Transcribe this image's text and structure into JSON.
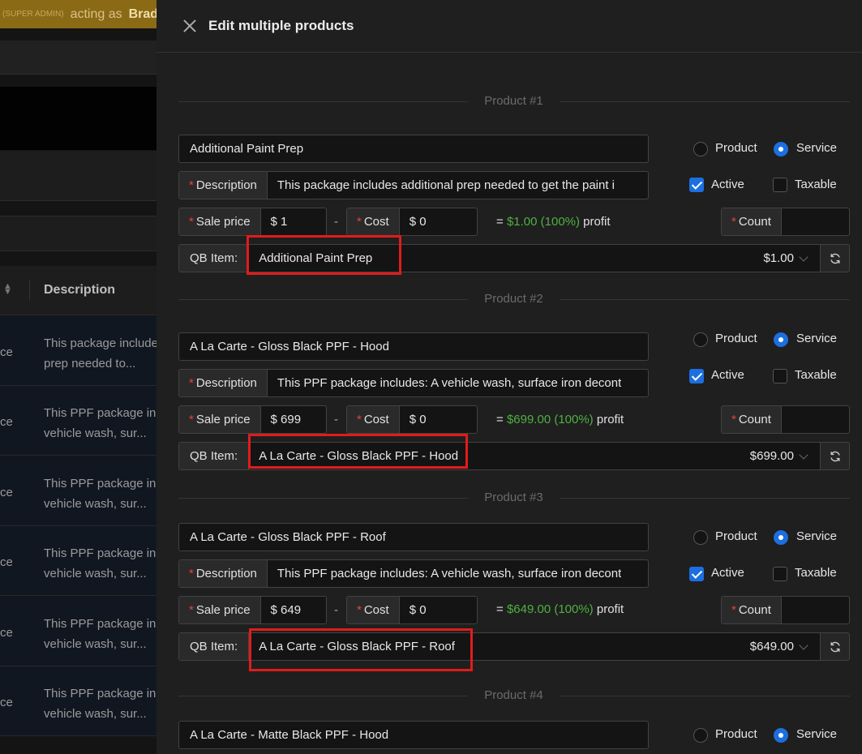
{
  "background": {
    "banner": {
      "role": "(SUPER ADMIN)",
      "acting": "acting as",
      "user": "Brad"
    },
    "table": {
      "description_header": "Description",
      "rows": [
        {
          "type": "ce",
          "line1": "This package include",
          "line2": "prep needed to..."
        },
        {
          "type": "ce",
          "line1": "This PPF package inc",
          "line2": "vehicle wash, sur..."
        },
        {
          "type": "ce",
          "line1": "This PPF package inc",
          "line2": "vehicle wash, sur..."
        },
        {
          "type": "ce",
          "line1": "This PPF package inc",
          "line2": "vehicle wash, sur..."
        },
        {
          "type": "ce",
          "line1": "This PPF package inc",
          "line2": "vehicle wash, sur..."
        },
        {
          "type": "ce",
          "line1": "This PPF package inc",
          "line2": "vehicle wash, sur..."
        }
      ]
    }
  },
  "drawer": {
    "title": "Edit multiple products",
    "labels": {
      "description": "Description",
      "sale_price": "Sale price",
      "cost": "Cost",
      "count": "Count",
      "qb_item": "QB Item:",
      "product": "Product",
      "service": "Service",
      "active": "Active",
      "taxable": "Taxable",
      "dash": "-",
      "profit_word": "profit"
    },
    "products": [
      {
        "heading": "Product #1",
        "name": "Additional Paint Prep",
        "description": "This package includes additional prep needed to get the paint i",
        "sale_price": "$ 1",
        "cost": "$ 0",
        "profit_prefix": "=",
        "profit_value": "$1.00 (100%)",
        "count": "",
        "qb_item": "Additional Paint Prep",
        "qb_price": "$1.00",
        "kind": "Service",
        "active": true,
        "taxable": false
      },
      {
        "heading": "Product #2",
        "name": "A La Carte - Gloss Black PPF - Hood",
        "description": "This PPF package includes:  A vehicle wash, surface iron decont",
        "sale_price": "$ 699",
        "cost": "$ 0",
        "profit_prefix": "=",
        "profit_value": "$699.00 (100%)",
        "count": "",
        "qb_item": "A La Carte - Gloss Black PPF - Hood",
        "qb_price": "$699.00",
        "kind": "Service",
        "active": true,
        "taxable": false
      },
      {
        "heading": "Product #3",
        "name": "A La Carte - Gloss Black PPF - Roof",
        "description": "This PPF package includes:  A vehicle wash, surface iron decont",
        "sale_price": "$ 649",
        "cost": "$ 0",
        "profit_prefix": "=",
        "profit_value": "$649.00 (100%)",
        "count": "",
        "qb_item": "A La Carte - Gloss Black PPF - Roof",
        "qb_price": "$649.00",
        "kind": "Service",
        "active": true,
        "taxable": false
      },
      {
        "heading": "Product #4",
        "name": "A La Carte - Matte Black PPF - Hood",
        "kind": "Service"
      }
    ]
  },
  "colors": {
    "accent": "#1c6fe0",
    "profit_green": "#4fb041",
    "required": "#e0443e",
    "highlight": "#e21b1b"
  }
}
